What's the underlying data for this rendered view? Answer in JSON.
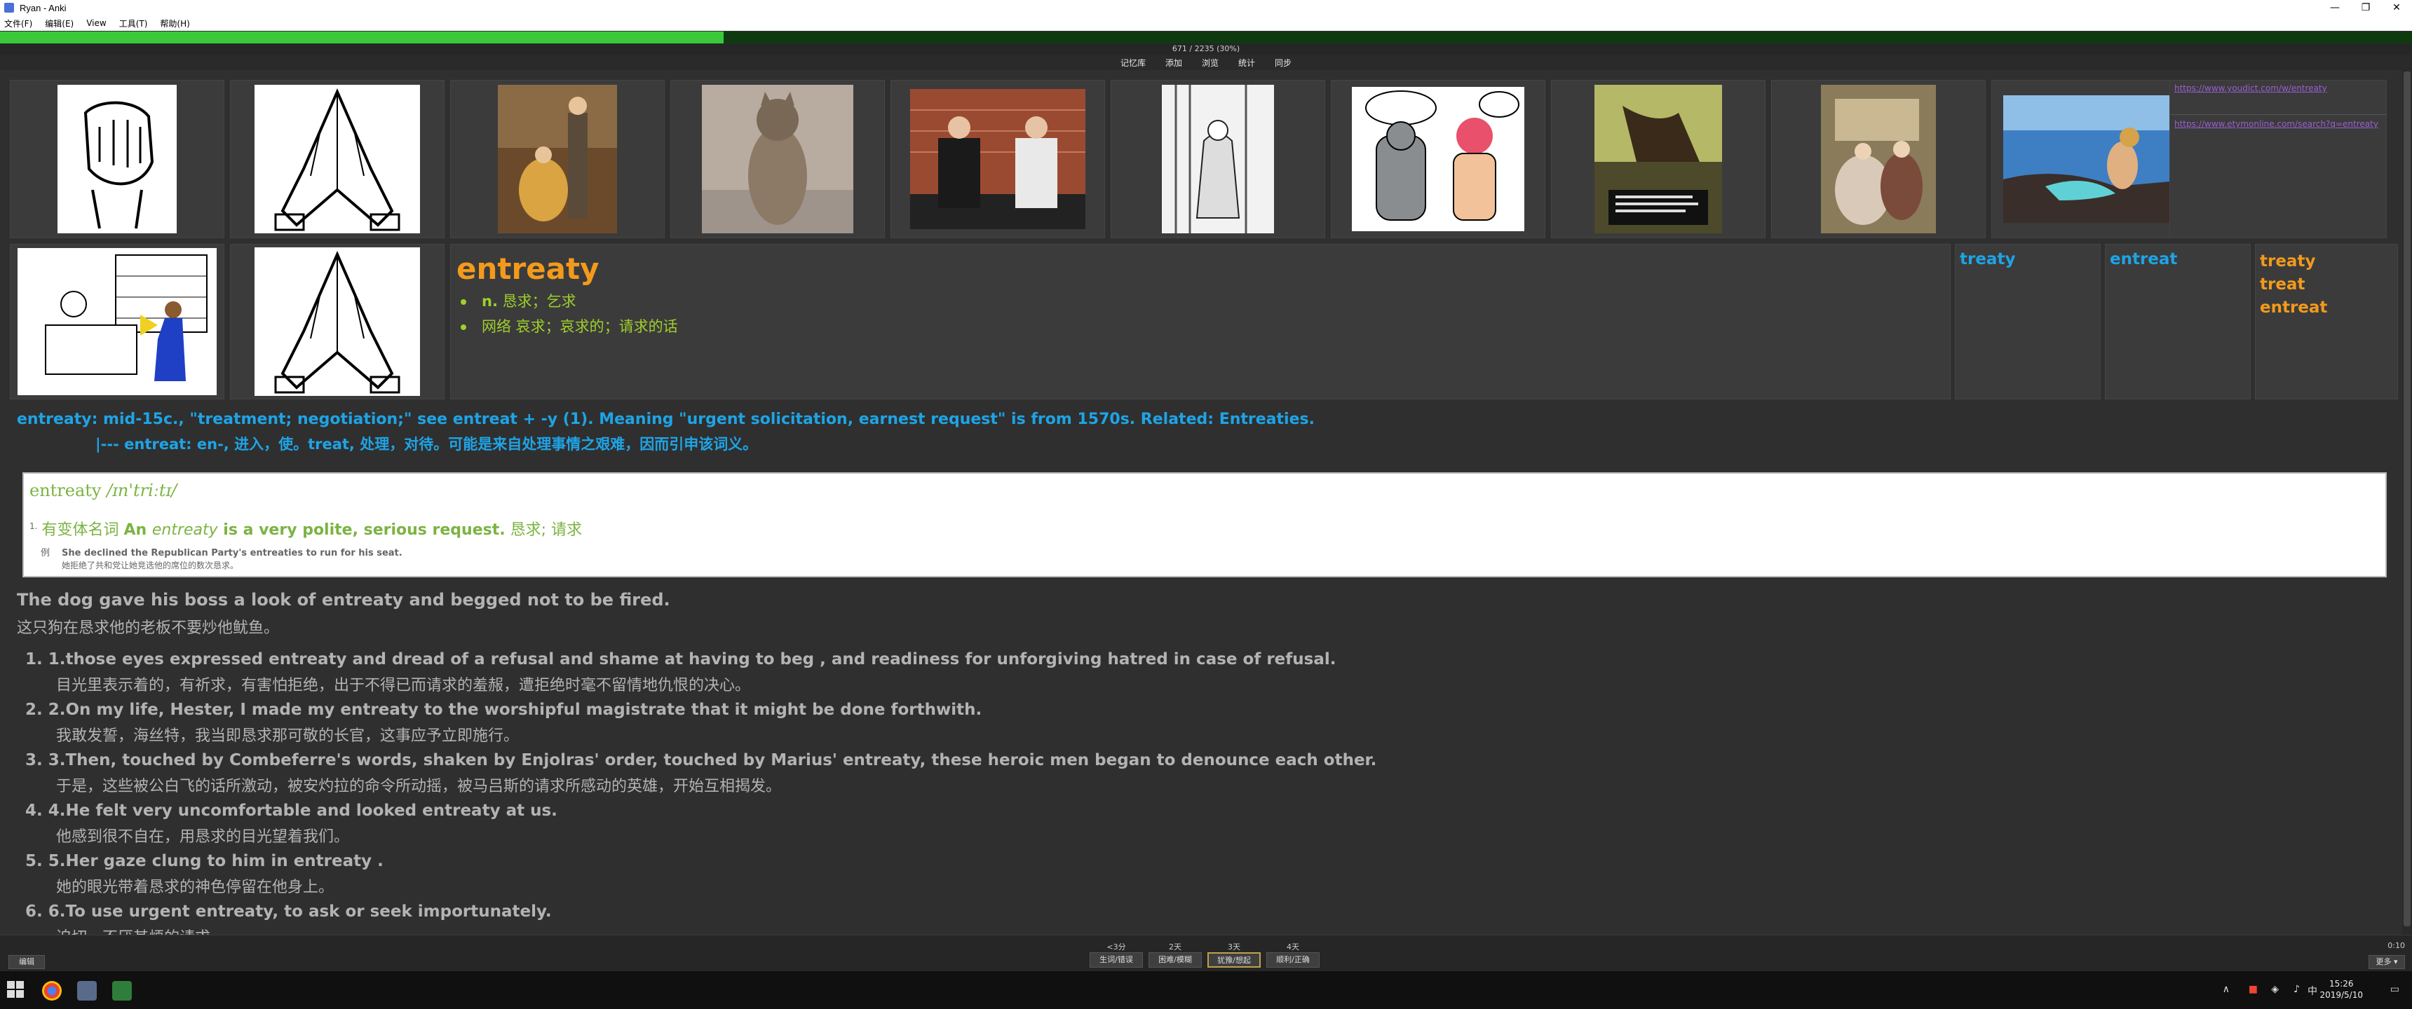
{
  "window": {
    "title": "Ryan - Anki"
  },
  "menu": [
    "文件(F)",
    "编辑(E)",
    "View",
    "工具(T)",
    "帮助(H)"
  ],
  "progress": {
    "text": "671 / 2235 (30%)",
    "fraction": 0.3
  },
  "toolbar": [
    "记忆库",
    "添加",
    "浏览",
    "统计",
    "同步"
  ],
  "images": [
    {
      "name": "clasped-hands-image"
    },
    {
      "name": "praying-hands-image"
    },
    {
      "name": "kneeling-woman-painting-image"
    },
    {
      "name": "begging-cat-image"
    },
    {
      "name": "seated-couple-photo-image"
    },
    {
      "name": "kneeling-figure-sketch-image"
    },
    {
      "name": "comic-robot-and-woman-image"
    },
    {
      "name": "kneeling-figure-poster-image"
    },
    {
      "name": "victorian-painting-image"
    },
    {
      "name": "mermaid-photo-image"
    }
  ],
  "links": [
    "https://www.youdict.com/w/entreaty",
    "https://www.etymonline.com/search?q=entreaty"
  ],
  "word": {
    "title": "entreaty",
    "defs": [
      {
        "pos": "n.",
        "text": " 恳求；乞求"
      },
      {
        "pos": "网络",
        "text": " 哀求；哀求的；请求的话"
      }
    ]
  },
  "related": {
    "col1": "treaty",
    "col2": "entreat",
    "col3": [
      "treaty",
      "treat",
      "entreat"
    ]
  },
  "etymology": {
    "line1": "entreaty: mid-15c., \"treatment; negotiation;\" see entreat + -y (1). Meaning \"urgent solicitation, earnest request\" is from 1570s. Related: Entreaties.",
    "line2": "|--- entreat: en-, 进入，使。treat, 处理，对待。可能是来自处理事情之艰难，因而引申该词义。"
  },
  "dictionary": {
    "headword": "entreaty",
    "ipa": "/ɪn'triːtɪ/",
    "sense_num": "1.",
    "sense_pre": "有变体名词 ",
    "sense_b1": "An ",
    "sense_i": "entreaty",
    "sense_b2": " is a very polite, serious request.",
    "sense_zh": " 恳求; 请求",
    "ex_label": "例",
    "ex_en": "She declined the Republican Party's entreaties to run for his seat.",
    "ex_zh": "她拒绝了共和党让她竞选他的席位的数次恳求。"
  },
  "sentences": {
    "main_en": "The dog gave his boss a look of entreaty and begged not to be fired.",
    "main_zh": "这只狗在恳求他的老板不要炒他鱿鱼。",
    "items": [
      {
        "en": "1. 1.those eyes expressed entreaty and dread of a refusal and shame at having to beg , and readiness for unforgiving hatred in case of refusal.",
        "zh": "目光里表示着的，有祈求，有害怕拒绝，出于不得已而请求的羞赧，遭拒绝时毫不留情地仇恨的决心。"
      },
      {
        "en": "2. 2.On my life, Hester, I made my entreaty to the worshipful magistrate that it might be done forthwith.",
        "zh": "我敢发誓，海丝特，我当即恳求那可敬的长官，这事应予立即施行。"
      },
      {
        "en": "3. 3.Then, touched by Combeferre's words, shaken by Enjolras' order, touched by Marius' entreaty, these heroic men began to denounce each other.",
        "zh": "于是，这些被公白飞的话所激动，被安灼拉的命令所动摇，被马吕斯的请求所感动的英雄，开始互相揭发。"
      },
      {
        "en": "4. 4.He felt very uncomfortable and looked entreaty at us.",
        "zh": "他感到很不自在，用恳求的目光望着我们。"
      },
      {
        "en": "5. 5.Her gaze clung to him in entreaty .",
        "zh": "她的眼光带着恳求的神色停留在他身上。"
      },
      {
        "en": "6. 6.To use urgent entreaty, to ask or seek importunately.",
        "zh": "迫切，不厌其烦的请求。"
      }
    ]
  },
  "bottom": {
    "edit": "编辑",
    "more": "更多 ▾",
    "timer": "0:10",
    "ease": [
      {
        "ivl": "<3分",
        "label": "生词/错误"
      },
      {
        "ivl": "2天",
        "label": "困难/模糊"
      },
      {
        "ivl": "3天",
        "label": "犹豫/想起"
      },
      {
        "ivl": "4天",
        "label": "顺利/正确"
      }
    ]
  },
  "taskbar": {
    "time": "15:26",
    "date": "2019/5/10"
  },
  "colors": {
    "accent_orange": "#f39a1c",
    "accent_blue": "#1ea4e6",
    "accent_green": "#9fcf2c",
    "progress_green": "#39c93b"
  }
}
